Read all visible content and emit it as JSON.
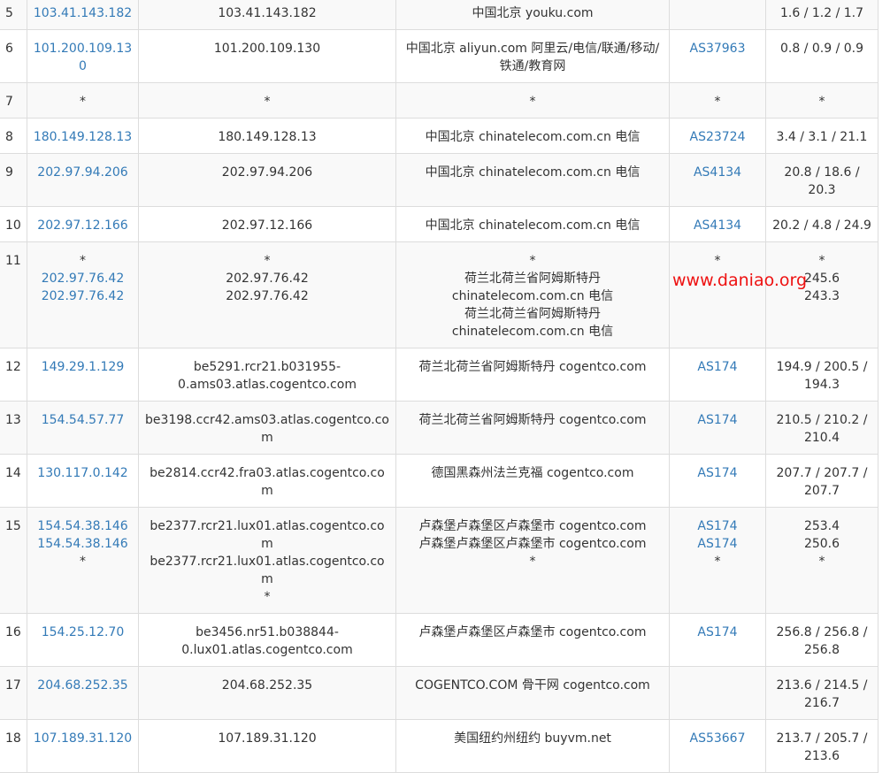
{
  "watermark": "www.daniao.org",
  "rows": [
    {
      "hop": "5",
      "ip": [
        "103.41.143.182"
      ],
      "host": [
        "103.41.143.182"
      ],
      "location": [
        "中国北京 youku.com"
      ],
      "asn": [
        ""
      ],
      "times": "1.6 / 1.2 / 1.7"
    },
    {
      "hop": "6",
      "ip": [
        "101.200.109.130"
      ],
      "host": [
        "101.200.109.130"
      ],
      "location": [
        "中国北京 aliyun.com 阿里云/电信/联通/移动/铁通/教育网"
      ],
      "asn": [
        "AS37963"
      ],
      "times": "0.8 / 0.9 / 0.9"
    },
    {
      "hop": "7",
      "ip": [
        "*"
      ],
      "host": [
        "*"
      ],
      "location": [
        "*"
      ],
      "asn": [
        "*"
      ],
      "times": "*"
    },
    {
      "hop": "8",
      "ip": [
        "180.149.128.13"
      ],
      "host": [
        "180.149.128.13"
      ],
      "location": [
        "中国北京 chinatelecom.com.cn 电信"
      ],
      "asn": [
        "AS23724"
      ],
      "times": "3.4 / 3.1 / 21.1"
    },
    {
      "hop": "9",
      "ip": [
        "202.97.94.206"
      ],
      "host": [
        "202.97.94.206"
      ],
      "location": [
        "中国北京 chinatelecom.com.cn 电信"
      ],
      "asn": [
        "AS4134"
      ],
      "times": "20.8 / 18.6 / 20.3"
    },
    {
      "hop": "10",
      "ip": [
        "202.97.12.166"
      ],
      "host": [
        "202.97.12.166"
      ],
      "location": [
        "中国北京 chinatelecom.com.cn 电信"
      ],
      "asn": [
        "AS4134"
      ],
      "times": "20.2 / 4.8 / 24.9"
    },
    {
      "hop": "11",
      "ip": [
        "*",
        "202.97.76.42",
        "202.97.76.42"
      ],
      "host": [
        "*",
        "202.97.76.42",
        "202.97.76.42"
      ],
      "location": [
        "*",
        "荷兰北荷兰省阿姆斯特丹",
        "chinatelecom.com.cn 电信",
        "荷兰北荷兰省阿姆斯特丹",
        "chinatelecom.com.cn 电信"
      ],
      "asn": [
        "*"
      ],
      "times": "*\n245.6\n243.3"
    },
    {
      "hop": "12",
      "ip": [
        "149.29.1.129"
      ],
      "host": [
        "be5291.rcr21.b031955-0.ams03.atlas.cogentco.com"
      ],
      "location": [
        "荷兰北荷兰省阿姆斯特丹 cogentco.com"
      ],
      "asn": [
        "AS174"
      ],
      "times": "194.9 / 200.5 / 194.3"
    },
    {
      "hop": "13",
      "ip": [
        "154.54.57.77"
      ],
      "host": [
        "be3198.ccr42.ams03.atlas.cogentco.com"
      ],
      "location": [
        "荷兰北荷兰省阿姆斯特丹 cogentco.com"
      ],
      "asn": [
        "AS174"
      ],
      "times": "210.5 / 210.2 / 210.4"
    },
    {
      "hop": "14",
      "ip": [
        "130.117.0.142"
      ],
      "host": [
        "be2814.ccr42.fra03.atlas.cogentco.com"
      ],
      "location": [
        "德国黑森州法兰克福 cogentco.com"
      ],
      "asn": [
        "AS174"
      ],
      "times": "207.7 / 207.7 / 207.7"
    },
    {
      "hop": "15",
      "ip": [
        "154.54.38.146",
        "154.54.38.146",
        "*"
      ],
      "host": [
        "be2377.rcr21.lux01.atlas.cogentco.com",
        "be2377.rcr21.lux01.atlas.cogentco.com",
        "*"
      ],
      "location": [
        "卢森堡卢森堡区卢森堡市 cogentco.com",
        "卢森堡卢森堡区卢森堡市 cogentco.com",
        "*"
      ],
      "asn": [
        "AS174",
        "AS174",
        "*"
      ],
      "times": "253.4\n250.6\n*"
    },
    {
      "hop": "16",
      "ip": [
        "154.25.12.70"
      ],
      "host": [
        "be3456.nr51.b038844-0.lux01.atlas.cogentco.com"
      ],
      "location": [
        "卢森堡卢森堡区卢森堡市 cogentco.com"
      ],
      "asn": [
        "AS174"
      ],
      "times": "256.8 / 256.8 / 256.8"
    },
    {
      "hop": "17",
      "ip": [
        "204.68.252.35"
      ],
      "host": [
        "204.68.252.35"
      ],
      "location": [
        "COGENTCO.COM 骨干网 cogentco.com"
      ],
      "asn": [
        ""
      ],
      "times": "213.6 / 214.5 / 216.7"
    },
    {
      "hop": "18",
      "ip": [
        "107.189.31.120"
      ],
      "host": [
        "107.189.31.120"
      ],
      "location": [
        "美国纽约州纽约 buyvm.net"
      ],
      "asn": [
        "AS53667"
      ],
      "times": "213.7 / 205.7 / 213.6"
    }
  ]
}
